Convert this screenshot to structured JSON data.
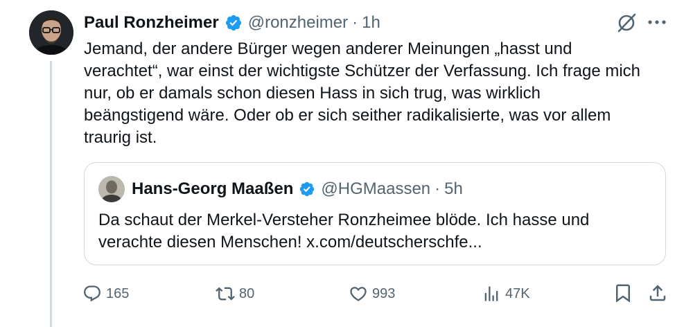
{
  "author": {
    "name": "Paul Ronzheimer",
    "handle": "@ronzheimer",
    "separator": "·",
    "time": "1h"
  },
  "tweet": {
    "lines": [
      "Jemand, der andere Bürger wegen anderer Meinungen „hasst und",
      "verachtet“, war einst der wichtigste Schützer der Verfassung. Ich frage mich",
      "nur, ob er damals schon diesen Hass in sich trug, was wirklich",
      "beängstigend wäre. Oder ob er sich seither radikalisierte, was vor allem",
      "traurig ist."
    ]
  },
  "quote": {
    "name": "Hans-Georg Maaßen",
    "handle": "@HGMaassen",
    "separator": "·",
    "time": "5h",
    "lines": [
      "Da schaut der Merkel-Versteher Ronzheimee blöde.  Ich hasse und",
      "verachte diesen Menschen! x.com/deutscherschfe..."
    ]
  },
  "actions": {
    "replies": "165",
    "reposts": "80",
    "likes": "993",
    "views": "47K"
  },
  "colors": {
    "verified": "#1d9bf0",
    "secondary_text": "#536471",
    "border": "#cfd9de"
  },
  "icons": [
    "verified-badge-icon",
    "grok-icon",
    "more-icon",
    "reply-icon",
    "repost-icon",
    "like-icon",
    "views-icon",
    "bookmark-icon",
    "share-icon"
  ]
}
